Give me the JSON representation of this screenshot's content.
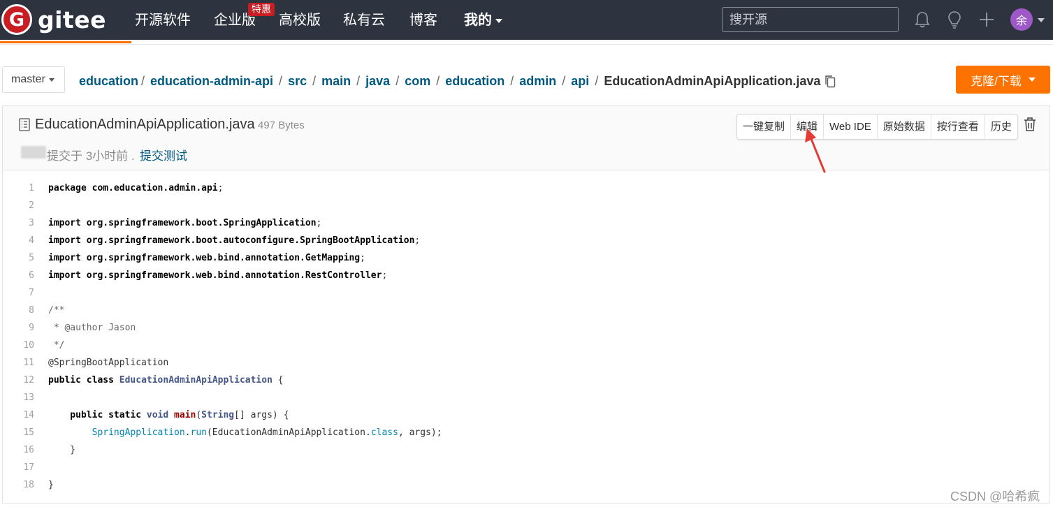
{
  "nav": {
    "logo_letter": "G",
    "logo_text": "gitee",
    "items": [
      "开源软件",
      "企业版",
      "高校版",
      "私有云",
      "博客",
      "我的"
    ],
    "badge": "特惠",
    "search_placeholder": "搜开源",
    "avatar_char": "余",
    "accent": "#fe7300",
    "bg": "#2e3340"
  },
  "breadcrumb": {
    "branch": "master",
    "path": [
      "education",
      "education-admin-api",
      "src",
      "main",
      "java",
      "com",
      "education",
      "admin",
      "api"
    ],
    "file": "EducationAdminApiApplication.java",
    "clone_label": "克隆/下载"
  },
  "file": {
    "name": "EducationAdminApiApplication.java",
    "size": "497 Bytes",
    "commit_text": "提交于 3小时前 .",
    "commit_msg": "提交测试",
    "buttons": [
      "一键复制",
      "编辑",
      "Web IDE",
      "原始数据",
      "按行查看",
      "历史"
    ]
  },
  "code": {
    "line_numbers": [
      "1",
      "2",
      "3",
      "4",
      "5",
      "6",
      "7",
      "8",
      "9",
      "10",
      "11",
      "12",
      "13",
      "14",
      "15",
      "16",
      "17",
      "18"
    ],
    "lines": [
      [
        {
          "t": "package ",
          "c": "kw"
        },
        {
          "t": "com.education.admin.api",
          "c": "kw"
        },
        {
          "t": ";",
          "c": ""
        }
      ],
      [],
      [
        {
          "t": "import ",
          "c": "kw"
        },
        {
          "t": "org.springframework.boot.SpringApplication",
          "c": "kw"
        },
        {
          "t": ";",
          "c": ""
        }
      ],
      [
        {
          "t": "import ",
          "c": "kw"
        },
        {
          "t": "org.springframework.boot.autoconfigure.SpringBootApplication",
          "c": "kw"
        },
        {
          "t": ";",
          "c": ""
        }
      ],
      [
        {
          "t": "import ",
          "c": "kw"
        },
        {
          "t": "org.springframework.web.bind.annotation.GetMapping",
          "c": "kw"
        },
        {
          "t": ";",
          "c": ""
        }
      ],
      [
        {
          "t": "import ",
          "c": "kw"
        },
        {
          "t": "org.springframework.web.bind.annotation.RestController",
          "c": "kw"
        },
        {
          "t": ";",
          "c": ""
        }
      ],
      [],
      [
        {
          "t": "/**",
          "c": "cm"
        }
      ],
      [
        {
          "t": " * @author Jason",
          "c": "cm"
        }
      ],
      [
        {
          "t": " */",
          "c": "cm"
        }
      ],
      [
        {
          "t": "@SpringBootApplication",
          "c": ""
        }
      ],
      [
        {
          "t": "public ",
          "c": "kw"
        },
        {
          "t": "class ",
          "c": "kw"
        },
        {
          "t": "EducationAdminApiApplication",
          "c": "cls"
        },
        {
          "t": " {",
          "c": ""
        }
      ],
      [],
      [
        {
          "t": "    public ",
          "c": "kw"
        },
        {
          "t": "static ",
          "c": "kw"
        },
        {
          "t": "void ",
          "c": "cls"
        },
        {
          "t": "main",
          "c": "fn"
        },
        {
          "t": "(",
          "c": ""
        },
        {
          "t": "String",
          "c": "cls"
        },
        {
          "t": "[] args) {",
          "c": ""
        }
      ],
      [
        {
          "t": "        SpringApplication",
          "c": "teal"
        },
        {
          "t": ".",
          "c": ""
        },
        {
          "t": "run",
          "c": "teal"
        },
        {
          "t": "(EducationAdminApiApplication.",
          "c": ""
        },
        {
          "t": "class",
          "c": "teal"
        },
        {
          "t": ", args);",
          "c": ""
        }
      ],
      [
        {
          "t": "    }",
          "c": ""
        }
      ],
      [],
      [
        {
          "t": "}",
          "c": ""
        }
      ]
    ]
  },
  "watermark": "CSDN @哈希疯"
}
